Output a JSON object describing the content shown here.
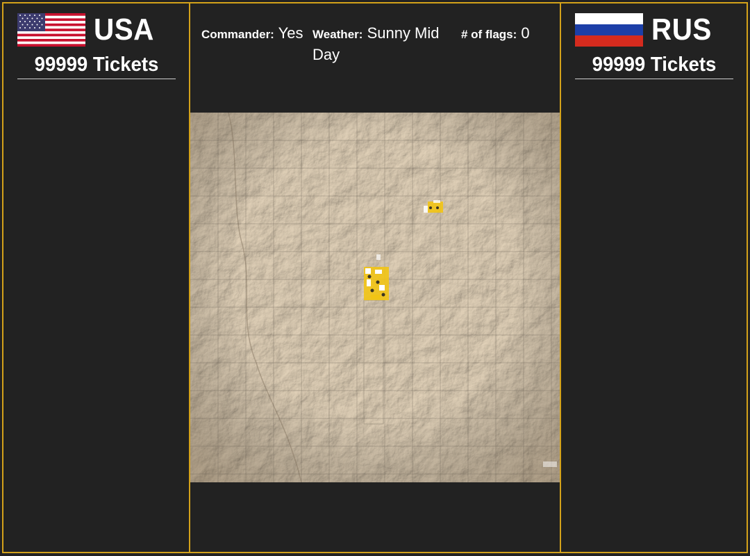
{
  "teams": {
    "left": {
      "name": "USA",
      "tickets": "99999 Tickets",
      "flag": "usa-flag-icon"
    },
    "right": {
      "name": "RUS",
      "tickets": "99999 Tickets",
      "flag": "russia-flag-icon"
    }
  },
  "info": {
    "commander_label": "Commander:",
    "commander_value": "Yes",
    "weather_label": "Weather:",
    "weather_value": "Sunny Mid Day",
    "flags_label": "# of flags:",
    "flags_value": "0"
  },
  "map": {
    "icon": "terrain-map",
    "marker_color": "#f2c414",
    "border_color": "#d4a21a",
    "background": "#222222"
  }
}
